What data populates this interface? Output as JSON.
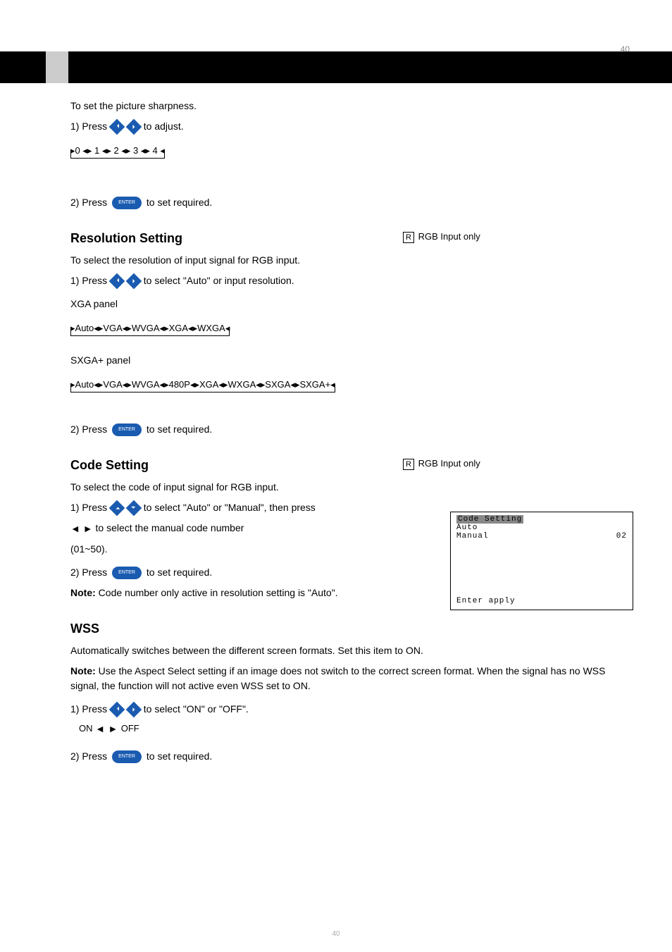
{
  "page": {
    "number_top": "40",
    "number_bottom": "40"
  },
  "sharpness_flow": "▸0 ◂▸ 1 ◂▸ 2 ◂▸ 3 ◂▸ 4 ◂",
  "section_sharpness": {
    "intro": "To set the picture sharpness.",
    "step1_prefix": "1) Press",
    "step1_suffix": "to adjust.",
    "step2_prefix": "2) Press",
    "step2_suffix": "to set required."
  },
  "section_resolution": {
    "title": "Resolution Setting",
    "rgb_prefix": "RGB Input only",
    "r_icon": "R",
    "intro": "To select the resolution of input signal for RGB input.",
    "step1_prefix": "1) Press",
    "step1_suffix": "to select \"Auto\" or input resolution.",
    "xga_label": "XGA panel",
    "xga_flow": "▸Auto◂▸VGA◂▸WVGA◂▸XGA◂▸WXGA◂",
    "sxga_label": "SXGA+ panel",
    "sxga_flow": "▸Auto◂▸VGA◂▸WVGA◂▸480P◂▸XGA◂▸WXGA◂▸SXGA◂▸SXGA+◂",
    "step2_prefix": "2) Press",
    "step2_suffix": "to set required."
  },
  "section_code": {
    "title": "Code Setting",
    "rgb_prefix": "RGB Input only",
    "r_icon": "R",
    "intro": "To select the code of input signal for RGB input.",
    "step1_prefix": "1) Press",
    "step1_mid": "to select \"Auto\" or \"Manual\", then press",
    "step1_suffix_a": " to select the manual code number",
    "step1_suffix_b": "(01~50).",
    "step2_prefix": "2) Press",
    "step2_suffix": "to set required.",
    "note_code_label": "Note:",
    "note_code_text": "Code number only active in resolution setting is \"Auto\"."
  },
  "section_wss": {
    "title": "WSS",
    "intro": "Automatically switches between the different screen formats. Set this item to ON.",
    "note_label": "Note:",
    "note_text": "Use the Aspect Select setting if an image does not switch to the correct screen format. When the signal has no WSS signal, the function will not active even WSS set to ON.",
    "step1_prefix": "1) Press",
    "step1_suffix": "to select \"ON\" or \"OFF\".",
    "onoff_flow": "ON ◂▸ OFF",
    "step2_prefix": "2) Press",
    "step2_suffix": "to set required."
  },
  "osd": {
    "title": "Code Setting",
    "row1": "Auto",
    "row2_label": "Manual",
    "row2_value": "02",
    "footer": "Enter apply"
  }
}
